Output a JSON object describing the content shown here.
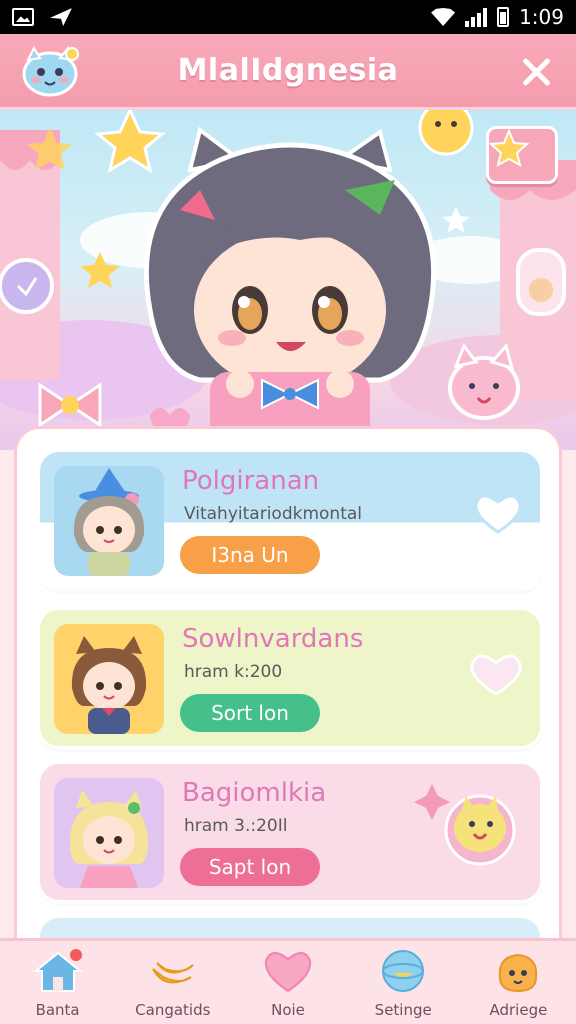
{
  "status_bar": {
    "time": "1:09"
  },
  "header": {
    "title": "MlalIdgnesia"
  },
  "cards": [
    {
      "name": "Polgiranan",
      "subtitle": "Vitahyitariodkmontal",
      "button": "I3na Un",
      "button_color": "#f7a047",
      "bg": "#d7eef8"
    },
    {
      "name": "Sowlnvardans",
      "subtitle": "hram k:200",
      "button": "Sort lon",
      "button_color": "#45c08a",
      "bg": "#eef5c9"
    },
    {
      "name": "Bagiomlkia",
      "subtitle": "hram 3.:20Il",
      "button": "Sapt lon",
      "button_color": "#ee6f96",
      "bg": "#fadbe8"
    }
  ],
  "nav": [
    {
      "label": "Banta",
      "icon": "home-icon"
    },
    {
      "label": "Cangatids",
      "icon": "banana-icon"
    },
    {
      "label": "Noie",
      "icon": "heart-icon"
    },
    {
      "label": "Setinge",
      "icon": "globe-icon"
    },
    {
      "label": "Adriege",
      "icon": "monster-icon"
    }
  ],
  "colors": {
    "accent": "#f49cad",
    "title_text": "#ffffff",
    "name_text": "#e078b8"
  }
}
